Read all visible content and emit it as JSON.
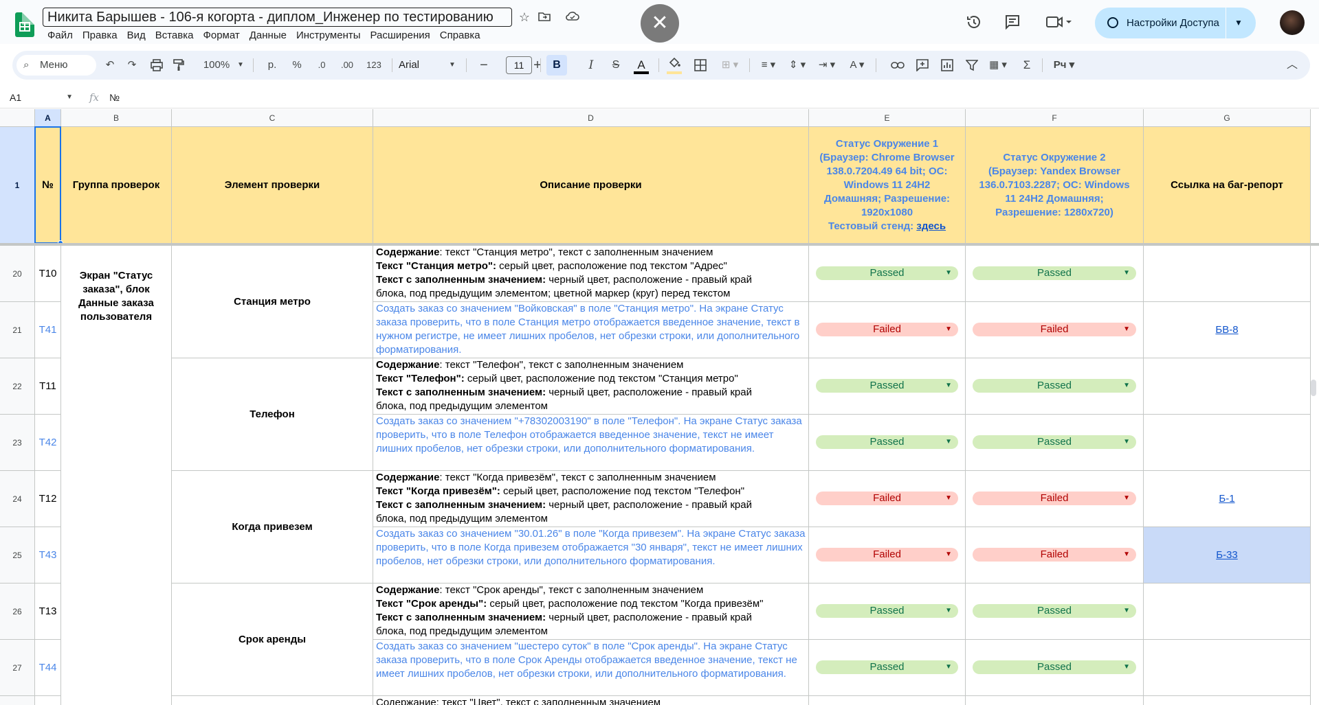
{
  "app": {
    "doc_title": "Никита Барышев - 106-я когорта - диплом_Инженер по тестированию",
    "menu": [
      "Файл",
      "Правка",
      "Вид",
      "Вставка",
      "Формат",
      "Данные",
      "Инструменты",
      "Расширения",
      "Справка"
    ],
    "share_label": "Настройки Доступа",
    "close_glyph": "✕"
  },
  "toolbar": {
    "search_label": "Меню",
    "zoom": "100%",
    "currency": "р.",
    "percent": "%",
    "dec_less": ".0",
    "dec_more": ".00",
    "number_format": "123",
    "font": "Arial",
    "font_size": "11",
    "bold": "B",
    "italic": "I",
    "strike": "S",
    "text_color": "A",
    "text_rotate": "A",
    "sigma": "Σ",
    "script_label": "Рч"
  },
  "formula": {
    "cell_ref": "A1",
    "fx": "fx",
    "content": "№"
  },
  "grid": {
    "columns": [
      "A",
      "B",
      "C",
      "D",
      "E",
      "F",
      "G"
    ],
    "header_row": {
      "row": "1",
      "a": "№",
      "b": "Группа проверок",
      "c": "Элемент проверки",
      "d": "Описание проверки",
      "e_lines": [
        "Статус Окружение 1",
        "(Браузер: Chrome Browser",
        "138.0.7204.49 64 bit; ОС:",
        "Windows 11 24H2",
        "Домашняя; Разрешение:",
        "1920x1080"
      ],
      "e_stand": "Тестовый стенд: ",
      "e_stand_link": "здесь",
      "f_lines": [
        "Статус Окружение 2",
        "(Браузер: Yandex Browser",
        "136.0.7103.2287; ОС: Windows",
        "11 24H2 Домашняя;",
        "Разрешение: 1280x720)"
      ],
      "g": "Ссылка на баг-репорт"
    },
    "group_label": "Экран \"Статус заказа\", блок Данные заказа пользователя",
    "elements": [
      "Станция метро",
      "Телефон",
      "Когда привезем",
      "Срок аренды"
    ],
    "rows": [
      {
        "row": "20",
        "id": "T10",
        "style": "spec",
        "lines": [
          [
            "Содержание",
            ": текст \"Станция метро\", текст с заполненным значением"
          ],
          [
            "Текст \"Станция метро\":",
            " серый цвет, расположение под текстом \"Адрес\""
          ],
          [
            "Текст с заполненным значением:",
            " черный цвет, расположение - правый край"
          ],
          [
            "",
            "блока, под предыдущим элементом; цветной маркер (круг) перед текстом"
          ]
        ],
        "e": "Passed",
        "f": "Passed",
        "g": ""
      },
      {
        "row": "21",
        "id": "T41",
        "style": "case",
        "text": "Создать заказ со значением \"Войковская\" в поле \"Станция метро\". На экране Статус заказа проверить, что в поле Станция метро отображается введенное значение, текст в нужном регистре, не имеет лишних пробелов, нет обрезки строки, или дополнительного форматирования.",
        "e": "Failed",
        "f": "Failed",
        "g": "БВ-8"
      },
      {
        "row": "22",
        "id": "T11",
        "style": "spec",
        "lines": [
          [
            "Содержание",
            ": текст \"Телефон\", текст с заполненным значением"
          ],
          [
            "Текст \"Телефон\":",
            " серый цвет, расположение под текстом \"Станция метро\""
          ],
          [
            "Текст с заполненным значением:",
            " черный цвет, расположение - правый край"
          ],
          [
            "",
            "блока, под предыдущим элементом"
          ]
        ],
        "e": "Passed",
        "f": "Passed",
        "g": ""
      },
      {
        "row": "23",
        "id": "T42",
        "style": "case",
        "text": "Создать заказ со значением \"+78302003190\" в поле \"Телефон\". На экране Статус заказа проверить, что в поле Телефон отображается введенное значение, текст не имеет лишних пробелов, нет обрезки строки, или дополнительного форматирования.",
        "e": "Passed",
        "f": "Passed",
        "g": ""
      },
      {
        "row": "24",
        "id": "T12",
        "style": "spec",
        "lines": [
          [
            "Содержание",
            ": текст \"Когда привезём\", текст с заполненным значением"
          ],
          [
            "Текст \"Когда привезём\":",
            " серый цвет, расположение под текстом \"Телефон\""
          ],
          [
            "Текст с заполненным значением:",
            " черный цвет, расположение - правый край"
          ],
          [
            "",
            "блока, под предыдущим элементом"
          ]
        ],
        "e": "Failed",
        "f": "Failed",
        "g": "Б-1"
      },
      {
        "row": "25",
        "id": "T43",
        "style": "case",
        "text": "Создать заказ со значением \"30.01.26\" в поле \"Когда привезем\". На экране Статус заказа проверить, что в поле Когда привезем отображается \"30 января\", текст не имеет лишних пробелов, нет обрезки строки, или дополнительного форматирования.",
        "e": "Failed",
        "f": "Failed",
        "g": "Б-33"
      },
      {
        "row": "26",
        "id": "T13",
        "style": "spec",
        "lines": [
          [
            "Содержание",
            ": текст \"Срок аренды\", текст с заполненным значением"
          ],
          [
            "Текст \"Срок аренды\":",
            " серый цвет, расположение под текстом \"Когда привезём\""
          ],
          [
            "Текст с заполненным значением:",
            " черный цвет, расположение - правый край"
          ],
          [
            "",
            "блока, под предыдущим элементом"
          ]
        ],
        "e": "Passed",
        "f": "Passed",
        "g": ""
      },
      {
        "row": "27",
        "id": "T44",
        "style": "case",
        "text": "Создать заказ со значением \"шестеро суток\" в поле \"Срок аренды\". На экране Статус заказа проверить, что в поле Срок Аренды отображается введенное значение, текст не имеет лишних пробелов, нет обрезки строки, или дополнительного форматирования.",
        "e": "Passed",
        "f": "Passed",
        "g": ""
      }
    ],
    "partial_row_text": "Содержание: текст \"Цвет\", текст с заполненным значением"
  },
  "colors": {
    "header_fill": "#ffe599",
    "passed_fill": "#d4edbc",
    "failed_fill": "#ffcfc9",
    "accent": "#1a73e8",
    "share_fill": "#c2e7ff"
  },
  "icons": [
    "search-icon",
    "undo-icon",
    "redo-icon",
    "print-icon",
    "paint-format-icon",
    "star-icon",
    "move-folder-icon",
    "cloud-icon",
    "history-icon",
    "comments-icon",
    "camera-icon",
    "globe-icon",
    "link-icon",
    "comment-add-icon",
    "chart-icon",
    "filter-icon",
    "chevron-up-icon"
  ]
}
